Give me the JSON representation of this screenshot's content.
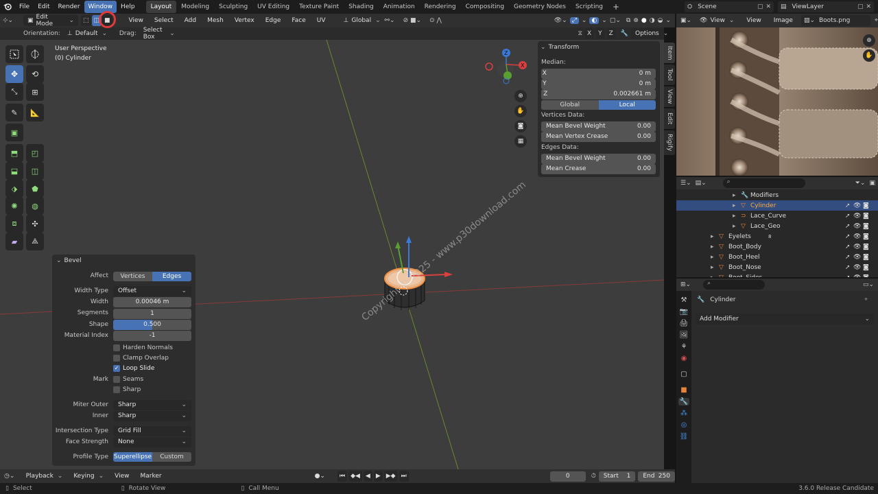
{
  "menubar": {
    "items": [
      "File",
      "Edit",
      "Render",
      "Window",
      "Help"
    ],
    "active": "Window",
    "workspaces": [
      "Layout",
      "Modeling",
      "Sculpting",
      "UV Editing",
      "Texture Paint",
      "Shading",
      "Animation",
      "Rendering",
      "Compositing",
      "Geometry Nodes",
      "Scripting"
    ],
    "active_workspace": "Layout",
    "scene": "Scene",
    "view_layer": "ViewLayer"
  },
  "viewport_header": {
    "mode": "Edit Mode",
    "menus": [
      "View",
      "Select",
      "Add",
      "Mesh",
      "Vertex",
      "Edge",
      "Face",
      "UV"
    ],
    "transform_orientation": "Global"
  },
  "tool_header": {
    "orientation_label": "Orientation:",
    "orientation": "Default",
    "drag_label": "Drag:",
    "drag": "Select Box",
    "axes": [
      "X",
      "Y",
      "Z"
    ],
    "options": "Options"
  },
  "viewport": {
    "perspective": "User Perspective",
    "object": "(0) Cylinder",
    "watermark": "Copyright © 2025 - www.p30download.com"
  },
  "transform_panel": {
    "title": "Transform",
    "median_label": "Median:",
    "x_label": "X",
    "x": "0 m",
    "y_label": "Y",
    "y": "0 m",
    "z_label": "Z",
    "z": "0.002661 m",
    "global": "Global",
    "local": "Local",
    "vertices_data": "Vertices Data:",
    "mean_bevel_weight_label": "Mean Bevel Weight",
    "mean_bevel_weight_v": "0.00",
    "mean_vertex_crease_label": "Mean Vertex Crease",
    "mean_vertex_crease": "0.00",
    "edges_data": "Edges Data:",
    "mean_bevel_weight_e": "0.00",
    "mean_crease_label": "Mean Crease",
    "mean_crease": "0.00"
  },
  "side_tabs": [
    "Item",
    "Tool",
    "View",
    "Edit",
    "Rigify"
  ],
  "bevel": {
    "title": "Bevel",
    "affect_label": "Affect",
    "affect_vertices": "Vertices",
    "affect_edges": "Edges",
    "width_type_label": "Width Type",
    "width_type": "Offset",
    "width_label": "Width",
    "width": "0.00046 m",
    "segments_label": "Segments",
    "segments": "1",
    "shape_label": "Shape",
    "shape": "0.500",
    "shape_fraction": 0.5,
    "material_index_label": "Material Index",
    "material_index": "-1",
    "harden_normals": "Harden Normals",
    "clamp_overlap": "Clamp Overlap",
    "loop_slide": "Loop Slide",
    "mark_label": "Mark",
    "seams": "Seams",
    "sharp": "Sharp",
    "miter_outer_label": "Miter Outer",
    "miter_outer": "Sharp",
    "inner_label": "Inner",
    "inner": "Sharp",
    "intersection_label": "Intersection Type",
    "intersection": "Grid Fill",
    "face_strength_label": "Face Strength",
    "face_strength": "None",
    "profile_type_label": "Profile Type",
    "profile_superellipse": "Superellipse",
    "profile_custom": "Custom"
  },
  "image_editor": {
    "view": "View",
    "view2": "View",
    "image": "Image",
    "file": "Boots.png"
  },
  "outliner": {
    "rows": [
      {
        "name": "Modifiers",
        "indent": 3,
        "kind": "wrench"
      },
      {
        "name": "Cylinder",
        "indent": 3,
        "kind": "mesh",
        "selected": true
      },
      {
        "name": "Lace_Curve",
        "indent": 3,
        "kind": "curve"
      },
      {
        "name": "Lace_Geo",
        "indent": 3,
        "kind": "mesh"
      },
      {
        "name": "Eyelets",
        "indent": 1,
        "kind": "mesh",
        "badge": "8"
      },
      {
        "name": "Boot_Body",
        "indent": 1,
        "kind": "mesh"
      },
      {
        "name": "Boot_Heel",
        "indent": 1,
        "kind": "mesh"
      },
      {
        "name": "Boot_Nose",
        "indent": 1,
        "kind": "mesh"
      },
      {
        "name": "Boot_Sides",
        "indent": 1,
        "kind": "mesh"
      }
    ]
  },
  "properties": {
    "object": "Cylinder",
    "add_modifier": "Add Modifier"
  },
  "timeline": {
    "playback": "Playback",
    "keying": "Keying",
    "view": "View",
    "marker": "Marker",
    "current_frame": "0",
    "start_label": "Start",
    "start": "1",
    "end_label": "End",
    "end": "250"
  },
  "statusbar": {
    "select": "Select",
    "rotate": "Rotate View",
    "call_menu": "Call Menu",
    "version": "3.6.0 Release Candidate"
  },
  "colors": {
    "accent": "#4772b3",
    "orange": "#e8833a",
    "highlight_ring": "#e03a3a"
  }
}
